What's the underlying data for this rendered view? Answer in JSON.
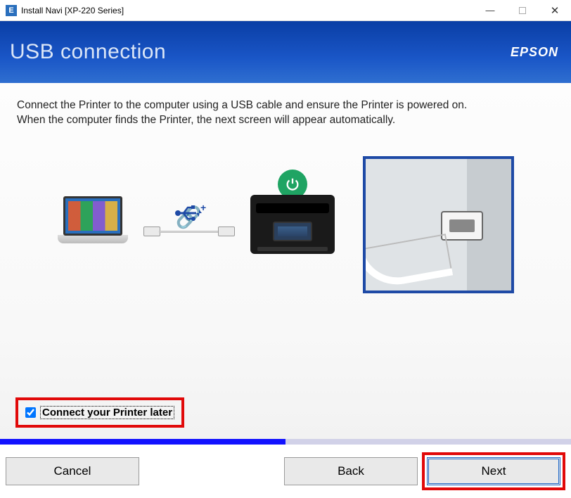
{
  "window": {
    "title": "Install Navi [XP-220 Series]",
    "app_icon_letter": "E"
  },
  "header": {
    "page_title": "USB connection",
    "brand": "EPSON"
  },
  "content": {
    "instruction_line1": "Connect the Printer to the computer using a USB cable and ensure the Printer is powered on.",
    "instruction_line2": "When the computer finds the Printer, the next screen will appear automatically.",
    "checkbox_label": "Connect your Printer later",
    "checkbox_checked": true
  },
  "footer": {
    "cancel": "Cancel",
    "back": "Back",
    "next": "Next"
  }
}
